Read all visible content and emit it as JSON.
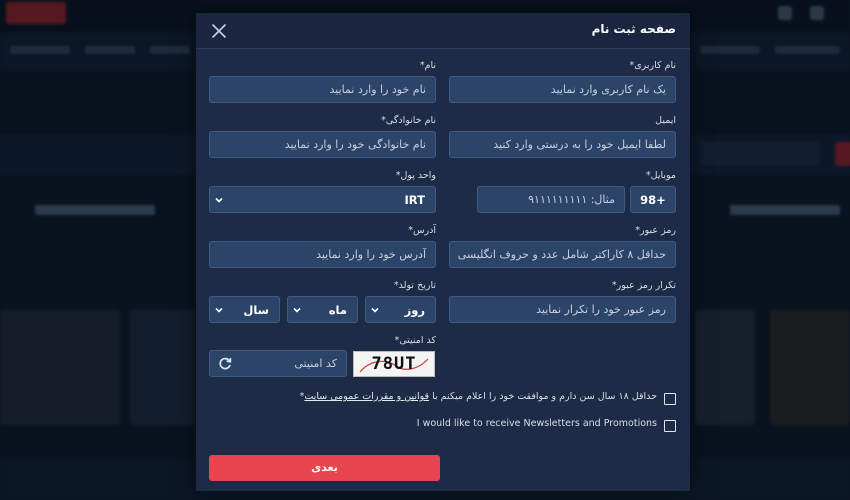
{
  "modal": {
    "title": "صفحه ثبت نام",
    "close_icon": "close-icon"
  },
  "fields": {
    "username": {
      "label": "نام کاربری*",
      "placeholder": "یک نام کاربری وارد نمایید"
    },
    "first_name": {
      "label": "نام*",
      "placeholder": "نام خود را وارد نمایید"
    },
    "email": {
      "label": "ایمیل",
      "placeholder": "لطفا ایمیل خود را به درستی وارد کنید"
    },
    "last_name": {
      "label": "نام خانوادگی*",
      "placeholder": "نام خانوادگی خود را وارد نمایید"
    },
    "mobile": {
      "label": "موبایل*",
      "prefix": "98+",
      "placeholder": "مثال: ۹۱۱۱۱۱۱۱۱۱"
    },
    "currency": {
      "label": "واحد پول*",
      "value": "IRT"
    },
    "password": {
      "label": "رمز عبور*",
      "placeholder": "حداقل ۸ کاراکتر شامل عدد و حروف انگلیسی"
    },
    "address": {
      "label": "آدرس*",
      "placeholder": "آدرس خود را وارد نمایید"
    },
    "password_confirm": {
      "label": "تکرار رمز عبور*",
      "placeholder": "رمز عبور خود را تکرار نمایید"
    },
    "birth_date": {
      "label": "تاریخ تولد*",
      "day": "روز",
      "month": "ماه",
      "year": "سال"
    },
    "captcha": {
      "label": "کد امنیتی*",
      "placeholder": "کد امنیتی",
      "image_text": "78UT"
    }
  },
  "checks": {
    "terms_text": "حداقل ۱۸ سال سن دارم و موافقت خود را اعلام میکنم با",
    "terms_link": "قوانین و مقررات عمومی سایت",
    "terms_star": "*",
    "newsletter": "I would like to receive Newsletters and Promotions"
  },
  "buttons": {
    "next": "بعدی"
  },
  "colors": {
    "modal_bg": "#1e2b46",
    "input_bg": "#2d4469",
    "primary_button": "#e84550"
  }
}
